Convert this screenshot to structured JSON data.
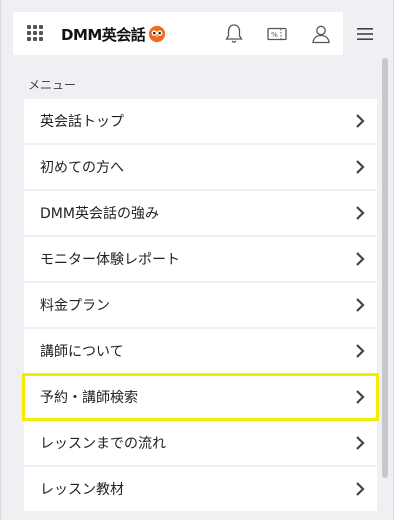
{
  "header": {
    "logo_text": "DMM英会話",
    "icons": {
      "apps": "grid-icon",
      "notifications": "bell-icon",
      "coupon": "coupon-icon",
      "account": "user-icon",
      "menu": "hamburger-icon"
    },
    "coupon_glyph": "%"
  },
  "menu": {
    "section_label": "メニュー",
    "items": [
      {
        "label": "英会話トップ"
      },
      {
        "label": "初めての方へ"
      },
      {
        "label": "DMM英会話の強み"
      },
      {
        "label": "モニター体験レポート"
      },
      {
        "label": "料金プラン"
      },
      {
        "label": "講師について"
      },
      {
        "label": "予約・講師検索",
        "highlighted": true
      },
      {
        "label": "レッスンまでの流れ"
      },
      {
        "label": "レッスン教材"
      }
    ]
  },
  "colors": {
    "highlight": "#f5ec00",
    "logo_accent": "#f26b1d",
    "background": "#eef0f4"
  }
}
